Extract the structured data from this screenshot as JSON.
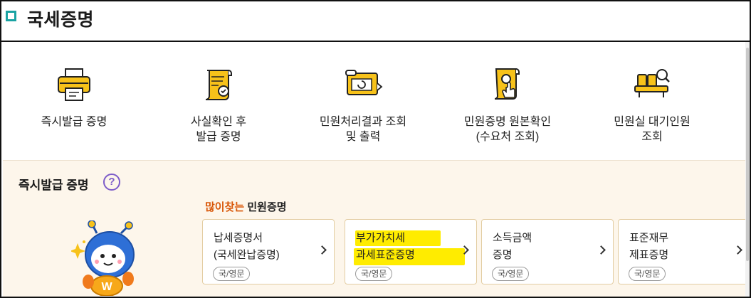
{
  "header": {
    "title": "국세증명"
  },
  "menu": [
    {
      "label": "즉시발급 증명",
      "icon": "printer-icon"
    },
    {
      "label": "사실확인 후\n발급 증명",
      "icon": "certificate-scroll-icon"
    },
    {
      "label": "민원처리결과 조회\n및 출력",
      "icon": "result-scroll-icon"
    },
    {
      "label": "민원증명 원본확인\n(수요처 조회)",
      "icon": "verify-document-icon"
    },
    {
      "label": "민원실 대기인원\n조회",
      "icon": "waiting-seats-icon"
    }
  ],
  "panel": {
    "title": "즉시발급 증명",
    "help": "?",
    "subhead_highlight": "많이찾는",
    "subhead_rest": " 민원증명"
  },
  "cards": [
    {
      "line1": "납세증명서",
      "line2": "(국세완납증명)",
      "badge": "국/영문",
      "highlighted": false
    },
    {
      "line1": "부가가치세",
      "line2": "과세표준증명",
      "badge": "국/영문",
      "highlighted": true
    },
    {
      "line1": "소득금액",
      "line2": "증명",
      "badge": "국/영문",
      "highlighted": false
    },
    {
      "line1": "표준재무",
      "line2": "제표증명",
      "badge": "국/영문",
      "highlighted": false
    }
  ],
  "colors": {
    "accent_orange": "#d9580a",
    "card_border": "#e3cda2",
    "panel_bg": "#fdf6eb",
    "highlight": "#ffec00",
    "help_purple": "#7d5cc9",
    "icon_yellow": "#f7c21a"
  }
}
